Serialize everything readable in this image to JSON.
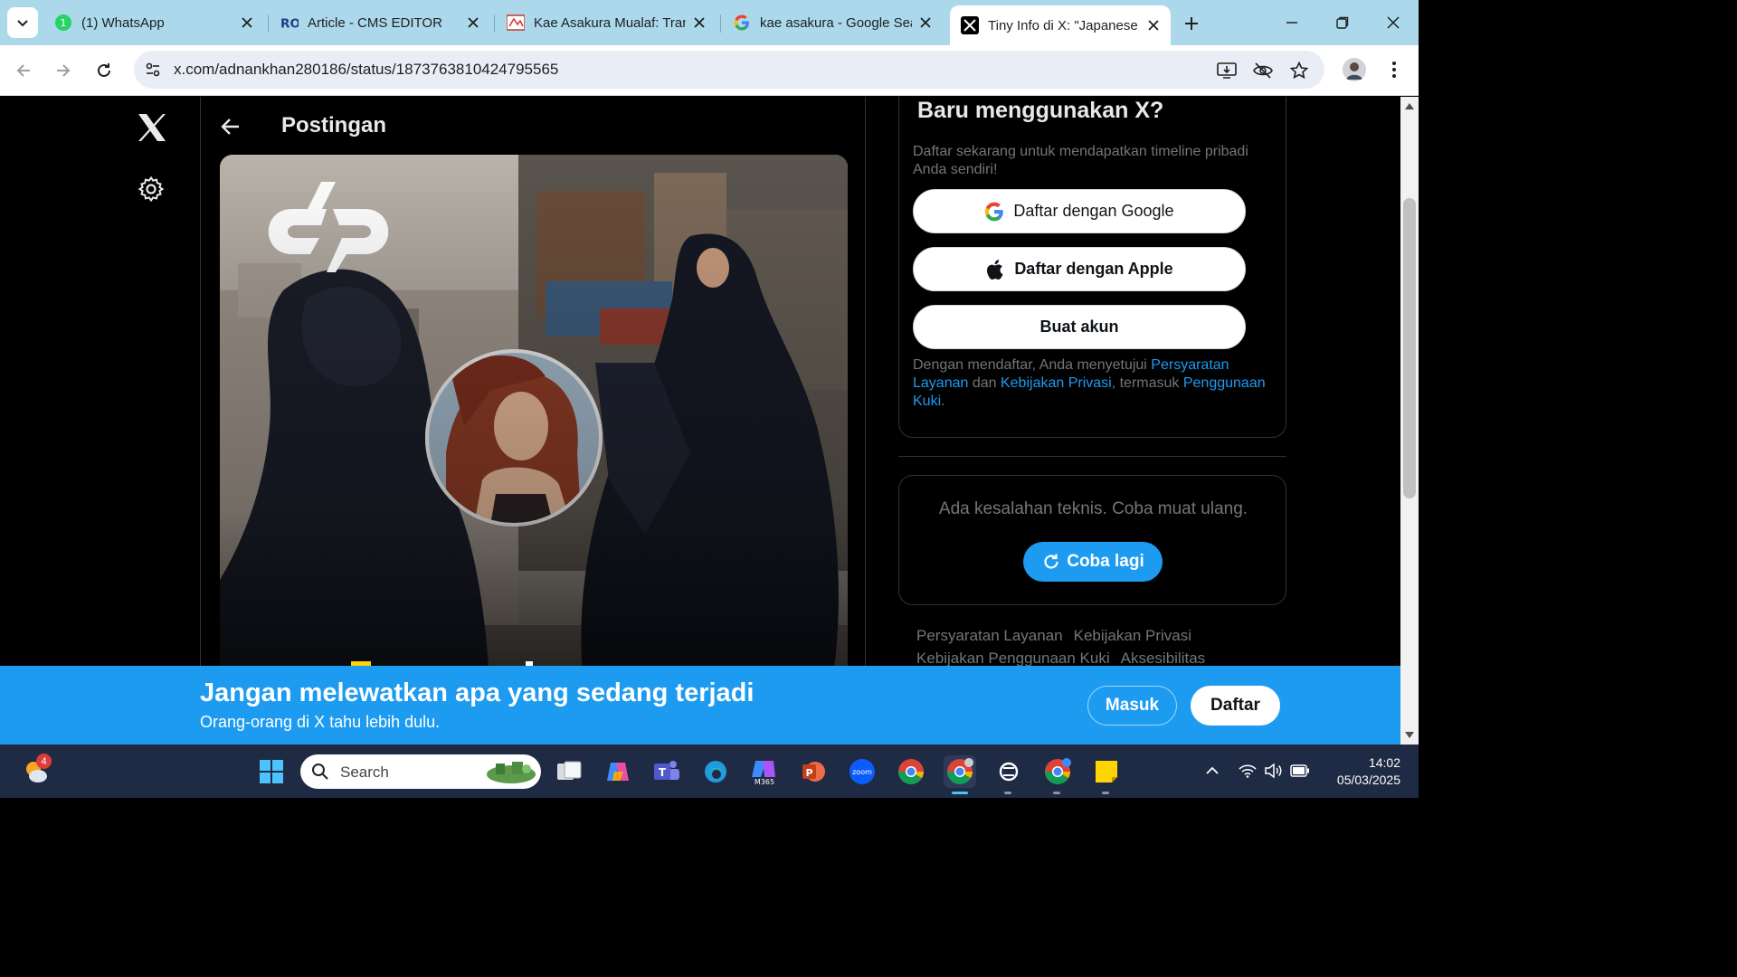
{
  "browser": {
    "tabs": [
      {
        "title": "(1) WhatsApp",
        "icon": "whatsapp-icon",
        "active": false
      },
      {
        "title": "Article - CMS EDITOR",
        "icon": "cms-icon",
        "active": false
      },
      {
        "title": "Kae Asakura Mualaf: Tran",
        "icon": "news-icon",
        "active": false
      },
      {
        "title": "kae asakura - Google Sea",
        "icon": "google-icon",
        "active": false
      },
      {
        "title": "Tiny Info di X: \"Japanese",
        "icon": "x-icon",
        "active": true
      }
    ],
    "url": "x.com/adnankhan280186/status/1873763810424795565"
  },
  "page": {
    "header_title": "Postingan",
    "signup": {
      "title": "Baru menggunakan X?",
      "subtitle": "Daftar sekarang untuk mendapatkan timeline pribadi Anda sendiri!",
      "google_label": "Daftar dengan Google",
      "apple_label": "Daftar dengan Apple",
      "create_label": "Buat akun",
      "terms_prefix": "Dengan mendaftar, Anda menyetujui ",
      "terms_link": "Persyaratan Layanan",
      "terms_mid": " dan ",
      "privacy_link": "Kebijakan Privasi",
      "terms_mid2": ", termasuk ",
      "cookie_link": "Penggunaan Kuki",
      "terms_end": "."
    },
    "error": {
      "text": "Ada kesalahan teknis. Coba muat ulang.",
      "retry_label": "Coba lagi"
    },
    "footer_links": [
      "Persyaratan Layanan",
      "Kebijakan Privasi",
      "Kebijakan Penggunaan Kuki",
      "Aksesibilitas"
    ],
    "banner": {
      "title": "Jangan melewatkan apa yang sedang terjadi",
      "subtitle": "Orang-orang di X tahu lebih dulu.",
      "login_label": "Masuk",
      "signup_label": "Daftar"
    }
  },
  "taskbar": {
    "search_placeholder": "Search",
    "weather_badge": "4",
    "time": "14:02",
    "date": "05/03/2025"
  },
  "colors": {
    "x_blue": "#1d9bf0",
    "tab_strip": "#abd9eb",
    "taskbar": "#1f2a44"
  }
}
